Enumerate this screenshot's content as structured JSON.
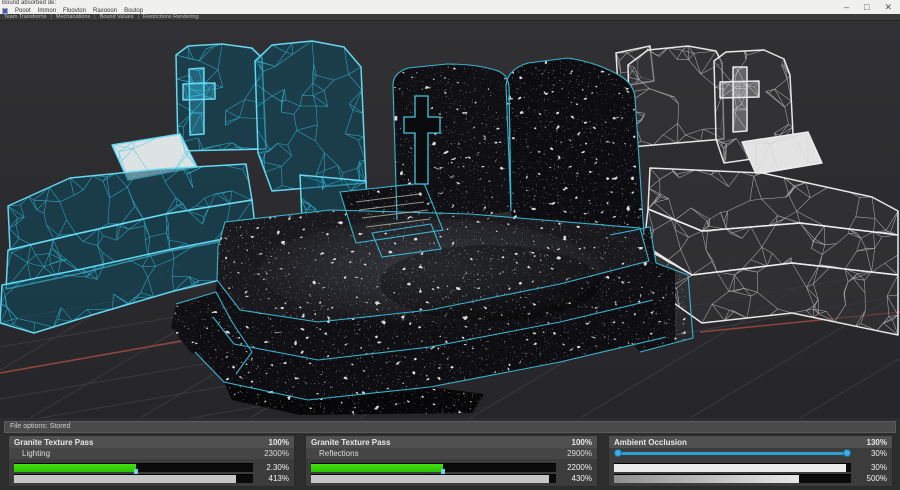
{
  "window": {
    "title": "Bound absorbed de:",
    "controls": {
      "minimize": "–",
      "maximize": "□",
      "close": "✕"
    }
  },
  "menu": {
    "items": [
      "Pooot",
      "Immon",
      "Floovton",
      "Raxooon",
      "Boutop"
    ]
  },
  "toolbar": {
    "separator": "|",
    "items": [
      "Team Transforms",
      "Mechanations",
      "Bound Values",
      "Restrictions Rendering"
    ]
  },
  "viewport": {
    "background": "#2a2a2c",
    "grid_color": "#3b3b3f",
    "axis_color": "#9e4a3e",
    "wireframe_left_color": "#34c6e8",
    "wireframe_right_color": "#d6d6d6",
    "granite_edge_color": "#3dbcd9"
  },
  "status_strip": {
    "label": "File options: Stored"
  },
  "panels": [
    {
      "title": "Granite Texture Pass",
      "title_value": "100%",
      "sub_label": "Lighting",
      "sub_value": "2300%",
      "bars": [
        {
          "kind": "green",
          "fill": 51,
          "value": "2.30%"
        },
        {
          "kind": "gray",
          "fill": 93,
          "value": "413%"
        }
      ]
    },
    {
      "title": "Granite Texture Pass",
      "title_value": "100%",
      "sub_label": "Reflections",
      "sub_value": "2900%",
      "bars": [
        {
          "kind": "green",
          "fill": 54,
          "value": "2200%"
        },
        {
          "kind": "gray",
          "fill": 97,
          "value": "430%"
        }
      ]
    },
    {
      "title": "Ambient Occlusion",
      "title_value": "130%",
      "slider": {
        "value": "30%"
      },
      "bars": [
        {
          "kind": "white",
          "fill": 98,
          "value": "30%"
        },
        {
          "kind": "gray2",
          "fill": 78,
          "value": "500%"
        }
      ]
    }
  ]
}
